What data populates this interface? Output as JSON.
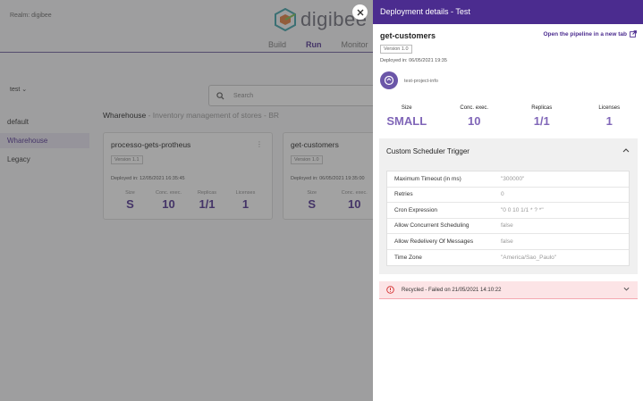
{
  "app": {
    "realm": "Realm: digibee",
    "logo_text": "digibee",
    "nav": [
      "Build",
      "Run",
      "Monitor"
    ],
    "environment": "test",
    "sidebar": [
      "default",
      "Wharehouse",
      "Legacy"
    ],
    "search_placeholder": "Search",
    "project_name": "Wharehouse",
    "project_desc": " - Inventory management of stores - BR",
    "cards": [
      {
        "name": "processo-gets-protheus",
        "version": "Version 1.1",
        "deployed": "Deployed in: 12/05/2021 16:35:45",
        "stats": [
          {
            "label": "Size",
            "value": "S"
          },
          {
            "label": "Conc. exec.",
            "value": "10"
          },
          {
            "label": "Replicas",
            "value": "1/1"
          },
          {
            "label": "Licenses",
            "value": "1"
          }
        ]
      },
      {
        "name": "get-customers",
        "version": "Version 1.0",
        "deployed": "Deployed in: 06/05/2021 19:35:00",
        "stats": [
          {
            "label": "Size",
            "value": "S"
          },
          {
            "label": "Conc. exec.",
            "value": "10"
          }
        ]
      }
    ]
  },
  "drawer": {
    "title": "Deployment details - Test",
    "pipeline_name": "get-customers",
    "open_link": "Open the pipeline in a new tab",
    "version": "Version 1.0",
    "deployed": "Deployed in: 06/05/2021 19:35",
    "project": "test-project-info",
    "stats": [
      {
        "label": "Size",
        "value": "SMALL"
      },
      {
        "label": "Conc. exec.",
        "value": "10"
      },
      {
        "label": "Replicas",
        "value": "1/1"
      },
      {
        "label": "Licenses",
        "value": "1"
      }
    ],
    "scheduler_title": "Custom Scheduler Trigger",
    "scheduler_rows": [
      {
        "key": "Maximum Timeout (in ms)",
        "value": "\"300000\""
      },
      {
        "key": "Retries",
        "value": "0"
      },
      {
        "key": "Cron Expression",
        "value": "\"0 0 10 1/1 * ? *\""
      },
      {
        "key": "Allow Concurrent Scheduling",
        "value": "false"
      },
      {
        "key": "Allow Redelivery Of Messages",
        "value": "false"
      },
      {
        "key": "Time Zone",
        "value": "\"America/Sao_Paulo\""
      }
    ],
    "recycled": "Recycled - Failed on 21/05/2021 14:10:22"
  },
  "colors": {
    "brand": "#4b2c8f",
    "stat_value": "#8066b8",
    "alert_bg": "#fce4e6"
  }
}
